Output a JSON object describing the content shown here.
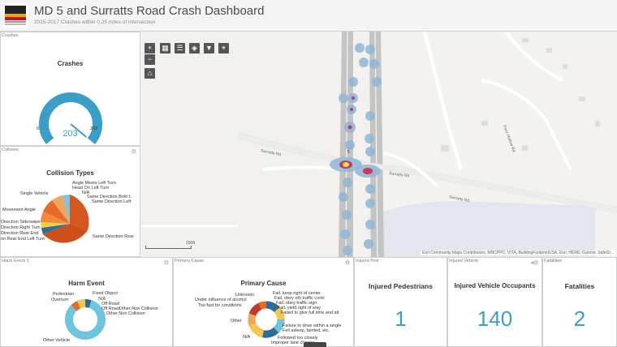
{
  "header": {
    "title": "MD 5 and Surratts Road Crash Dashboard",
    "subtitle": "2015-2017 Crashes within 0.25 miles of intersection"
  },
  "crashes": {
    "tab": "Crashes",
    "title": "Crashes",
    "value": "203",
    "min": "0",
    "max": "203",
    "fraction": 1.0
  },
  "collision": {
    "tab": "Collision",
    "title": "Collision Types",
    "labels": [
      "Angle Meets Left Turn",
      "Head On Left Turn",
      "N/A",
      "Same Direction Both L",
      "Same Direction Left",
      "Single Vehicle",
      "Movement Angle",
      "Direction Sideswipe",
      "Direction Right Turn",
      "Direction Rear End",
      "on Rear End Left Turn",
      "Same Direction Rear"
    ]
  },
  "harm": {
    "tab": "Harm Event 1",
    "title": "Harm Event",
    "labels": [
      "Pedestrian",
      "Overturn",
      "Fixed Object",
      "N/A",
      "Off Road",
      "Off RoadOther Non Collision",
      "Other Non Collision",
      "Other Vehicle"
    ]
  },
  "cause": {
    "tab": "Primary Cause",
    "title": "Primary Cause",
    "labels": [
      "Unknown",
      "Under influence of alcohol",
      "Too fast for conditions",
      "Other",
      "N/A",
      "Fail. keep right of center",
      "Fail. obey oth traffic contr",
      "Fail. obey traffic sign",
      "Fail. yield right of way",
      "Failed to give full time and att",
      "Failure to drive within a single",
      "Fell asleep, fainted, etc.",
      "Followed too closely",
      "Improper lane change"
    ]
  },
  "injured_ped": {
    "tab": "Injured Ped",
    "title": "Injured Pedestrians",
    "value": "1"
  },
  "injured_veh": {
    "tab": "Injured Vehicle",
    "title": "Injured Vehicle Occupants",
    "value": "140"
  },
  "fatalities": {
    "tab": "Fatalities",
    "title": "Fatalities",
    "value": "2"
  },
  "map": {
    "road_label_1": "Surratts Rd",
    "road_label_2": "Surratts Rd",
    "road_label_3": "Surratts Rd",
    "road_label_4": "Surratts Rd",
    "road_label_5": "Foxx Hollow Rd",
    "route_label": "5",
    "scale": "200ft",
    "attribution": "Esri Community Maps Contributors, MNCPPC, VITA, BuildingFootprintUSA, Esri, HERE, Garmin, SafeGr..."
  },
  "icons": [
    "zoom-in-icon",
    "zoom-out-icon",
    "home-icon",
    "basemap-icon",
    "list-icon",
    "layers-icon",
    "filter-icon",
    "locate-icon",
    "gear-icon"
  ],
  "colors": {
    "accent": "#3a9fc8",
    "gauge_bg": "#e6e6e6"
  }
}
